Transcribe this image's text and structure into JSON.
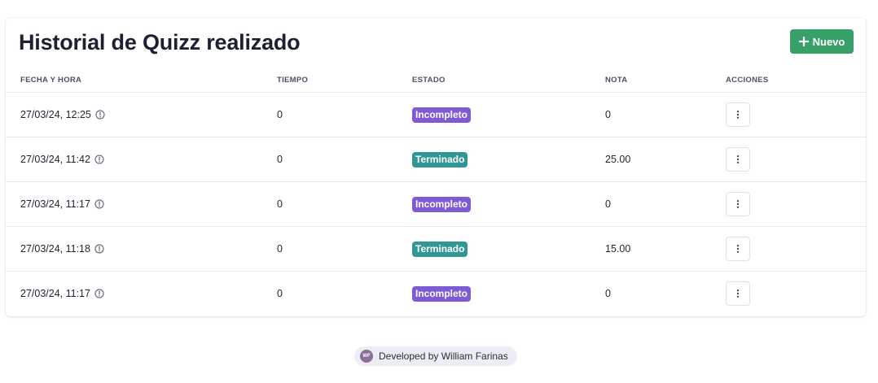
{
  "header": {
    "title": "Historial de Quizz realizado",
    "new_button_label": "Nuevo"
  },
  "table": {
    "columns": [
      "FECHA Y HORA",
      "TIEMPO",
      "ESTADO",
      "NOTA",
      "ACCIONES"
    ],
    "rows": [
      {
        "datetime": "27/03/24, 12:25",
        "time": "0",
        "status": "Incompleto",
        "grade": "0"
      },
      {
        "datetime": "27/03/24, 11:42",
        "time": "0",
        "status": "Terminado",
        "grade": "25.00"
      },
      {
        "datetime": "27/03/24, 11:17",
        "time": "0",
        "status": "Incompleto",
        "grade": "0"
      },
      {
        "datetime": "27/03/24, 11:18",
        "time": "0",
        "status": "Terminado",
        "grade": "15.00"
      },
      {
        "datetime": "27/03/24, 11:17",
        "time": "0",
        "status": "Incompleto",
        "grade": "0"
      }
    ]
  },
  "footer": {
    "avatar_initials": "WF",
    "text": "Developed by William Farinas"
  },
  "colors": {
    "primary_green": "#38a169",
    "incompleto": "#805ad5",
    "terminado": "#319795"
  },
  "icons": [
    "plus-icon",
    "info-icon",
    "more-vertical-icon"
  ]
}
